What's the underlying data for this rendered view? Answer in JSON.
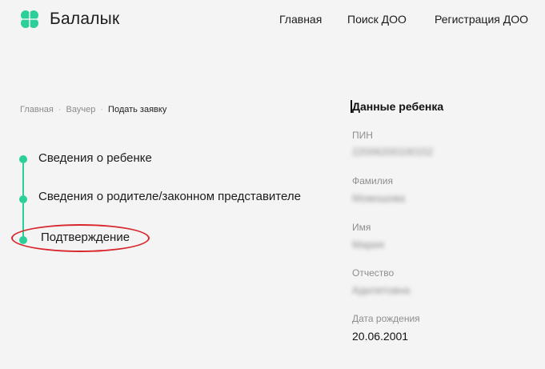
{
  "header": {
    "app_name": "Балалык",
    "nav": [
      "Главная",
      "Поиск ДОО",
      "Регистрация ДОО"
    ],
    "accent_color": "#2ccf9a"
  },
  "breadcrumb": {
    "items": [
      "Главная",
      "Ваучер"
    ],
    "separator": "·",
    "current": "Подать заявку"
  },
  "steps": [
    {
      "label": "Сведения о ребенке"
    },
    {
      "label": "Сведения о родителе/законном представителе"
    },
    {
      "label": "Подтверждение"
    }
  ],
  "child_data": {
    "title": "Данные ребенка",
    "fields": [
      {
        "label": "ПИН",
        "value": "22006200100152"
      },
      {
        "label": "Фамилия",
        "value": "Момошова"
      },
      {
        "label": "Имя",
        "value": "Мария"
      },
      {
        "label": "Отчество",
        "value": "Адилетовна"
      },
      {
        "label": "Дата рождения",
        "value": "20.06.2001"
      }
    ]
  }
}
